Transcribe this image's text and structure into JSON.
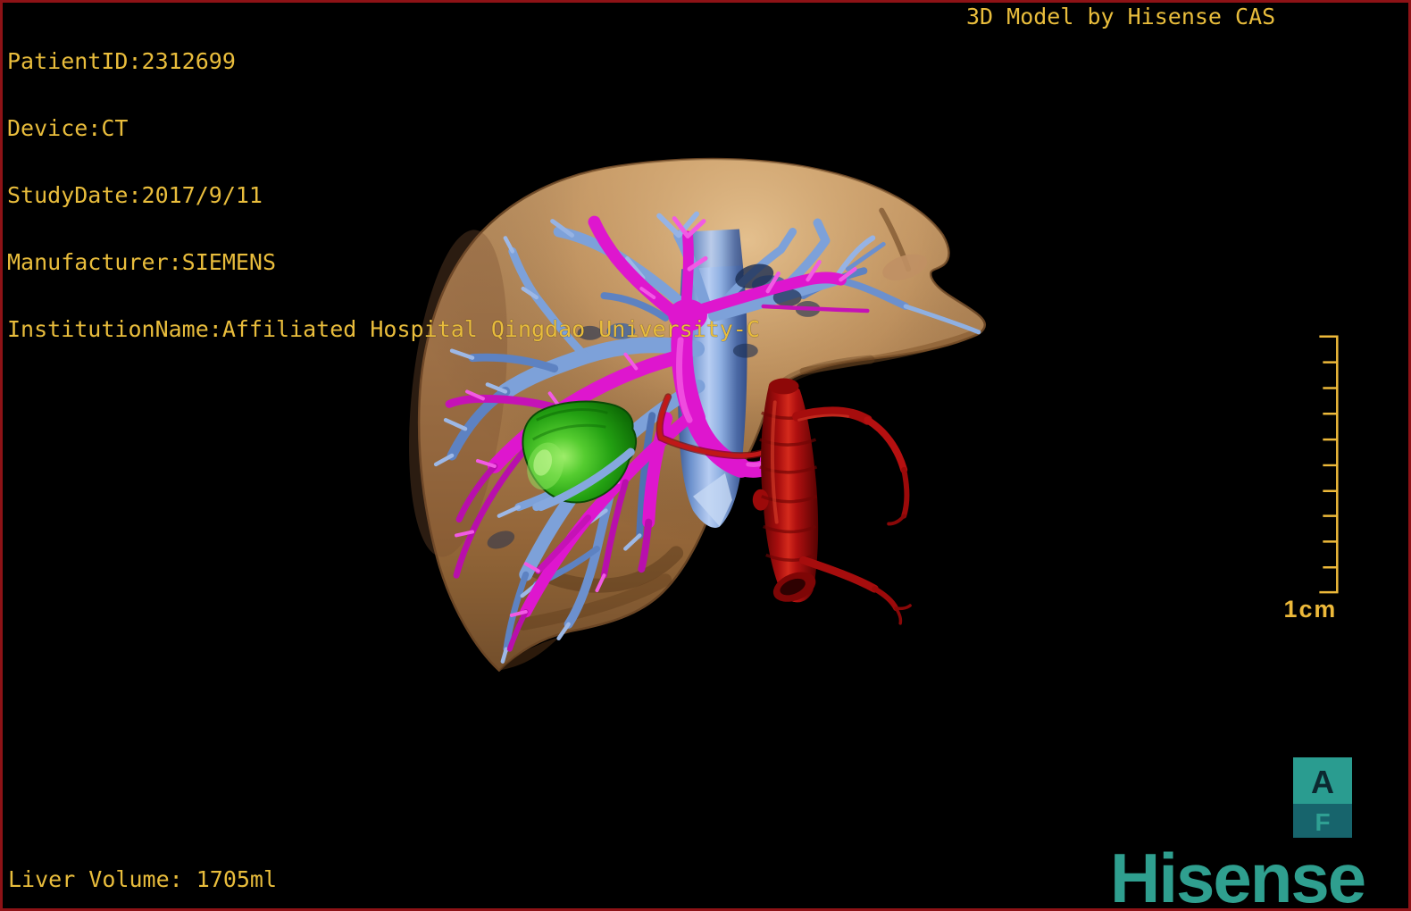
{
  "header": {
    "patient_info": [
      "PatientID:2312699",
      "Device:CT",
      "StudyDate:2017/9/11",
      "Manufacturer:SIEMENS",
      "InstitutionName:Affiliated Hospital Qingdao University-C"
    ],
    "watermark": "3D Model by Hisense CAS"
  },
  "footer": {
    "liver_volume": "Liver Volume: 1705ml"
  },
  "overlay_text_color": "#e9bd3c",
  "scale_ruler": {
    "label": "1cm",
    "color": "#edb93a"
  },
  "orientation_cube": {
    "front_label": "A",
    "secondary_label": "F",
    "front_face_color": "#2a9c90",
    "secondary_face_color": "#17646c",
    "front_letter_color": "#0c2830",
    "secondary_letter_color": "#2fa093"
  },
  "brand": {
    "logo_text": "Hisense",
    "logo_color": "#2f9f8f"
  },
  "model": {
    "structures": [
      {
        "name": "liver",
        "color": "#b5854f"
      },
      {
        "name": "hepatic-veins-ivc",
        "color": "#7da1d9"
      },
      {
        "name": "portal-vein",
        "color": "#de16ce"
      },
      {
        "name": "gallbladder",
        "color": "#2aa415"
      },
      {
        "name": "hepatic-artery-aorta",
        "color": "#b51010"
      }
    ]
  },
  "frame": {
    "border_color": "#8d1216",
    "background_color": "#000000"
  }
}
